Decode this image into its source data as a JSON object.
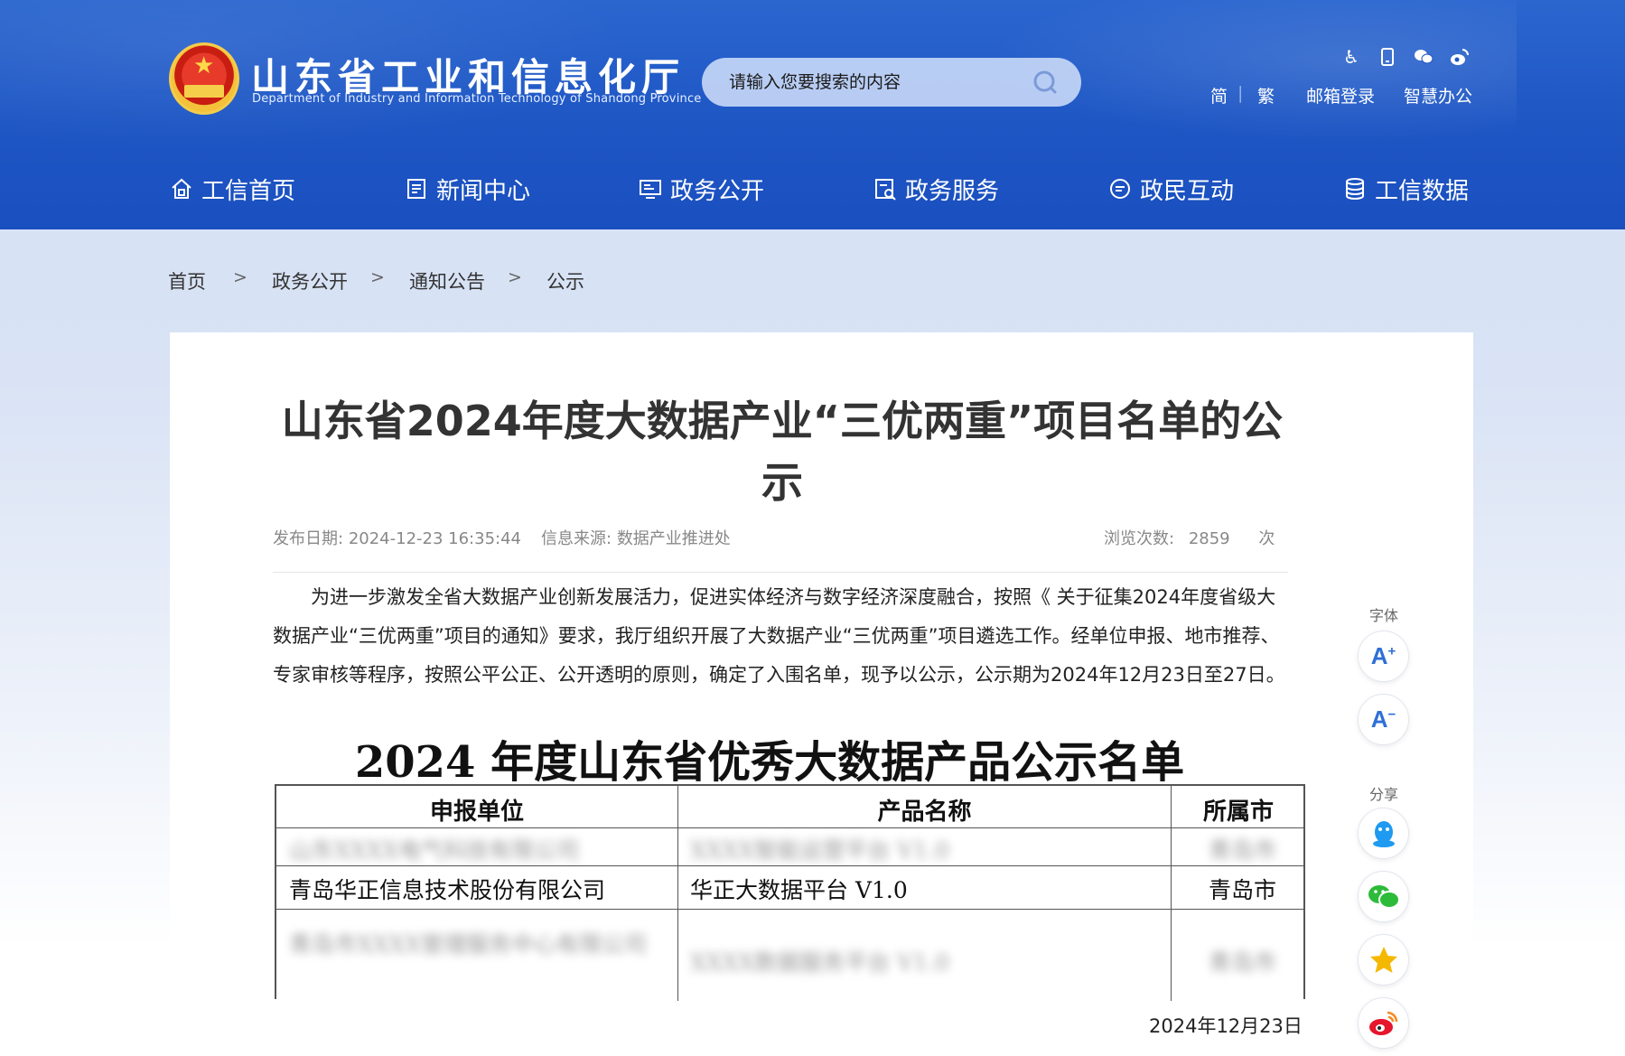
{
  "header": {
    "site_title": "山东省工业和信息化厅",
    "site_subtitle": "Department of Industry and Information Technology of Shandong Province",
    "search_placeholder": "请输入您要搜索的内容",
    "tool_icons": [
      "accessibility-icon",
      "mobile-icon",
      "wechat-icon",
      "weibo-icon"
    ],
    "links": {
      "simplified": "简",
      "separator": "|",
      "traditional": "繁",
      "mail_login": "邮箱登录",
      "smart_office": "智慧办公"
    }
  },
  "nav": {
    "items": [
      {
        "label": "工信首页",
        "icon": "home-icon"
      },
      {
        "label": "新闻中心",
        "icon": "news-icon"
      },
      {
        "label": "政务公开",
        "icon": "monitor-icon"
      },
      {
        "label": "政务服务",
        "icon": "service-icon"
      },
      {
        "label": "政民互动",
        "icon": "chat-icon"
      },
      {
        "label": "工信数据",
        "icon": "database-icon"
      }
    ]
  },
  "breadcrumb": {
    "items": [
      "首页",
      "政务公开",
      "通知公告",
      "公示"
    ],
    "separator": ">"
  },
  "article": {
    "title": "山东省2024年度大数据产业“三优两重”项目名单的公示",
    "publish_label": "发布日期:",
    "publish_date": "2024-12-23 16:35:44",
    "source_label": "信息来源:",
    "source": "数据产业推进处",
    "views_label": "浏览次数:",
    "views": "2859",
    "views_unit": "次",
    "body": "为进一步激发全省大数据产业创新发展活力，促进实体经济与数字经济深度融合，按照《 关于征集2024年度省级大数据产业“三优两重”项目的通知》要求，我厅组织开展了大数据产业“三优两重”项目遴选工作。经单位申报、地市推荐、专家审核等程序，按照公平公正、公开透明的原则，确定了入围名单，现予以公示，公示期为2024年12月23日至27日。",
    "sign_date": "2024年12月23日"
  },
  "notice_image": {
    "title": "2024 年度山东省优秀大数据产品公示名单",
    "headers": [
      "申报单位",
      "产品名称",
      "所属市"
    ],
    "rows": [
      {
        "unit": "山东XXXX电气科技有限公司",
        "product": "XXXX智能运营平台 V1.0",
        "city": "青岛市",
        "blurred": true
      },
      {
        "unit": "青岛华正信息技术股份有限公司",
        "product": "华正大数据平台 V1.0",
        "city": "青岛市",
        "blurred": false
      },
      {
        "unit": "青岛市XXXX管理服务中心有限公司",
        "product": "XXXX数据服务平台 V1.0",
        "city": "青岛市",
        "blurred": true
      }
    ]
  },
  "side_tools": {
    "font_label": "字体",
    "share_label": "分享",
    "font_increase": "A",
    "font_decrease": "A",
    "share_icons": [
      "qq-icon",
      "wechat-share-icon",
      "qzone-icon",
      "weibo-share-icon"
    ]
  },
  "colors": {
    "header_blue": "#1e56c4",
    "accent_blue": "#2f6fd6"
  }
}
